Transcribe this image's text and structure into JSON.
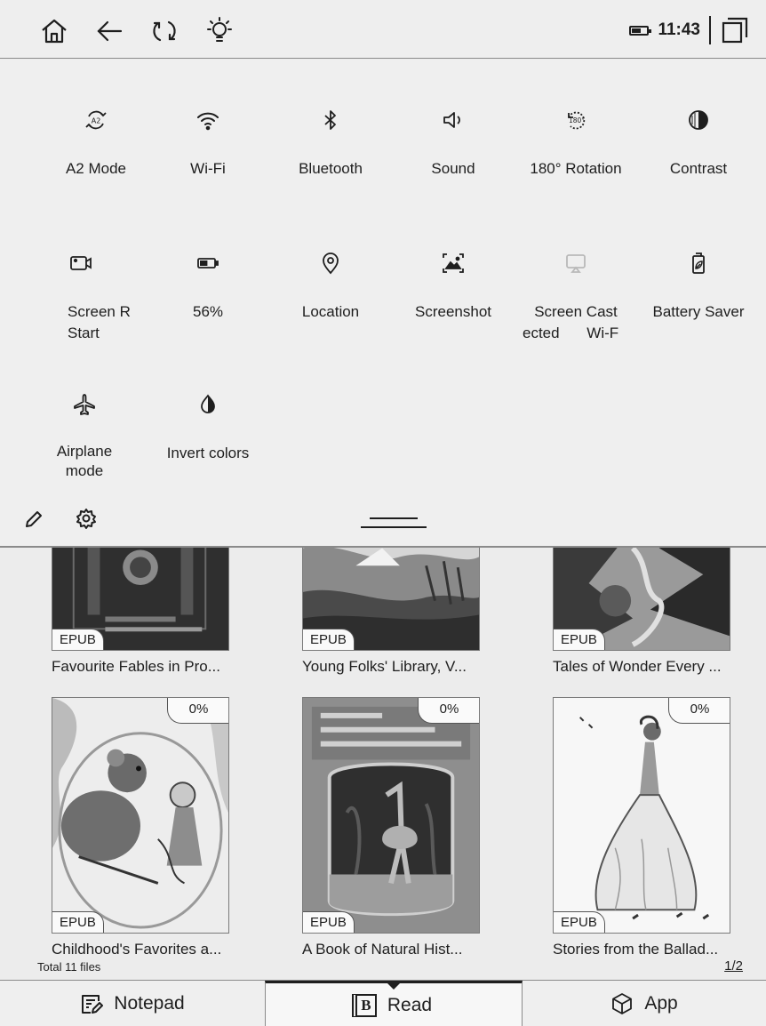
{
  "status_bar": {
    "icons": [
      "home-icon",
      "back-icon",
      "refresh-icon",
      "light-bulb-icon"
    ],
    "time": "11:43"
  },
  "quick_settings": {
    "tiles": [
      {
        "icon": "a2-mode-icon",
        "label": "A2 Mode",
        "sub": ""
      },
      {
        "icon": "wifi-icon",
        "label": "Wi-Fi",
        "sub": ""
      },
      {
        "icon": "bluetooth-icon",
        "label": "Bluetooth",
        "sub": ""
      },
      {
        "icon": "sound-icon",
        "label": "Sound",
        "sub": ""
      },
      {
        "icon": "rotation-180-icon",
        "label": "180° Rotation",
        "sub": ""
      },
      {
        "icon": "contrast-icon",
        "label": "Contrast",
        "sub": ""
      },
      {
        "icon": "screen-record-icon",
        "label": "Screen R",
        "sub": "Start"
      },
      {
        "icon": "battery-icon",
        "label": "56%",
        "sub": ""
      },
      {
        "icon": "location-icon",
        "label": "Location",
        "sub": ""
      },
      {
        "icon": "screenshot-icon",
        "label": "Screenshot",
        "sub": ""
      },
      {
        "icon": "screen-cast-icon",
        "label": "Screen Cast",
        "sub": "ected Wi-F"
      },
      {
        "icon": "battery-saver-icon",
        "label": "Battery Saver",
        "sub": ""
      },
      {
        "icon": "airplane-icon",
        "label": "Airplane",
        "sub": "mode"
      },
      {
        "icon": "invert-colors-icon",
        "label": "Invert colors",
        "sub": ""
      }
    ],
    "battery_level": 0.56
  },
  "library": {
    "books": [
      {
        "title": "Favourite Fables in Pro...",
        "format": "EPUB",
        "progress": ""
      },
      {
        "title": "Young Folks' Library, V...",
        "format": "EPUB",
        "progress": ""
      },
      {
        "title": "Tales of Wonder Every ...",
        "format": "EPUB",
        "progress": ""
      },
      {
        "title": "Childhood's Favorites a...",
        "format": "EPUB",
        "progress": "0%"
      },
      {
        "title": "A Book of Natural Hist...",
        "format": "EPUB",
        "progress": "0%"
      },
      {
        "title": "Stories from the Ballad...",
        "format": "EPUB",
        "progress": "0%"
      }
    ],
    "total": "Total 11 files",
    "page": "1/2"
  },
  "nav": {
    "tabs": [
      {
        "label": "Notepad",
        "icon": "notepad-icon"
      },
      {
        "label": "Read",
        "icon": "book-icon"
      },
      {
        "label": "App",
        "icon": "app-cube-icon"
      }
    ],
    "active": "Read"
  }
}
